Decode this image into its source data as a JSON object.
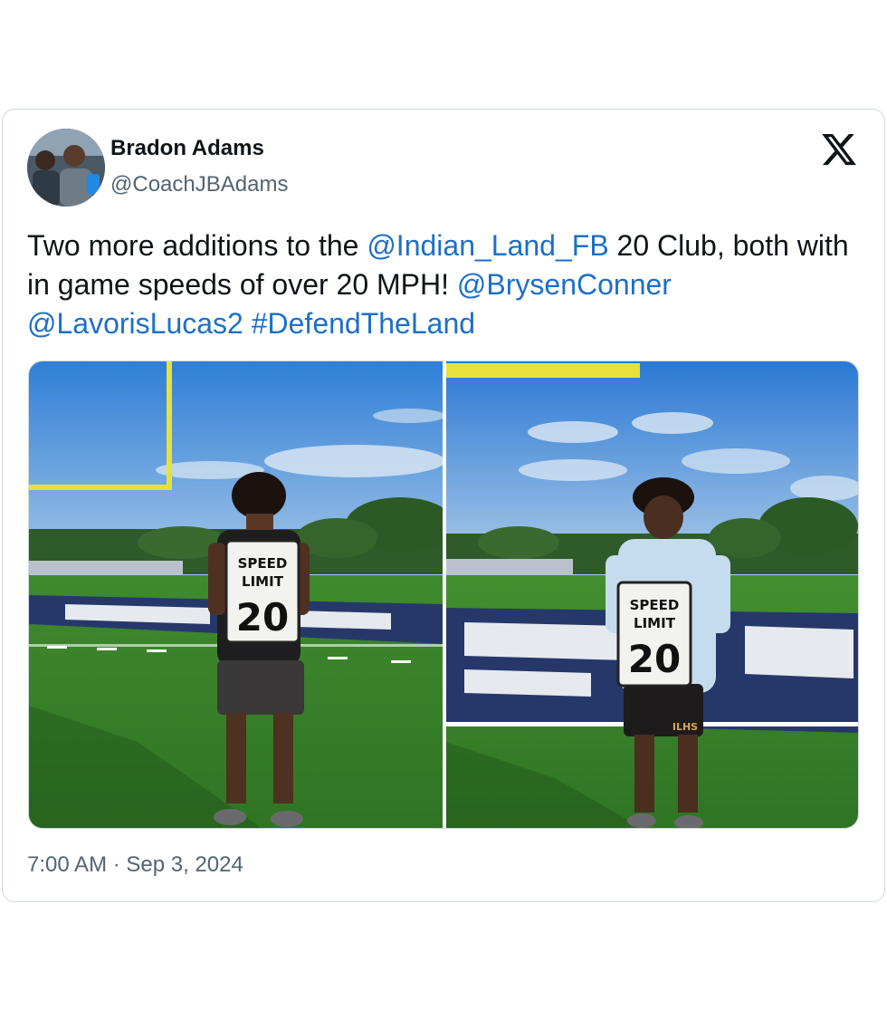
{
  "author": {
    "name": "Bradon Adams",
    "handle": "@CoachJBAdams",
    "avatar_icon": "profile-photo"
  },
  "platform_icon": "x-logo-icon",
  "tweet": {
    "segments": [
      {
        "text": "Two more additions to the ",
        "link": false
      },
      {
        "text": "@Indian_Land_FB",
        "link": true
      },
      {
        "text": " 20 Club, both with in game speeds of over 20 MPH! ",
        "link": false
      },
      {
        "text": "@BrysenConner",
        "link": true
      },
      {
        "text": " ",
        "link": false
      },
      {
        "text": "@LavorisLucas2",
        "link": true
      },
      {
        "text": " ",
        "link": false
      },
      {
        "text": "#DefendTheLand",
        "link": true
      }
    ]
  },
  "photos": [
    {
      "sign_line1": "SPEED",
      "sign_line2": "LIMIT",
      "sign_number": "20"
    },
    {
      "sign_line1": "SPEED",
      "sign_line2": "LIMIT",
      "sign_number": "20",
      "shorts_text": "ILHS"
    }
  ],
  "timestamp": "7:00 AM · Sep 3, 2024",
  "colors": {
    "link": "#1d6fc8",
    "secondary_text": "#536471",
    "border": "#cfd9de"
  }
}
